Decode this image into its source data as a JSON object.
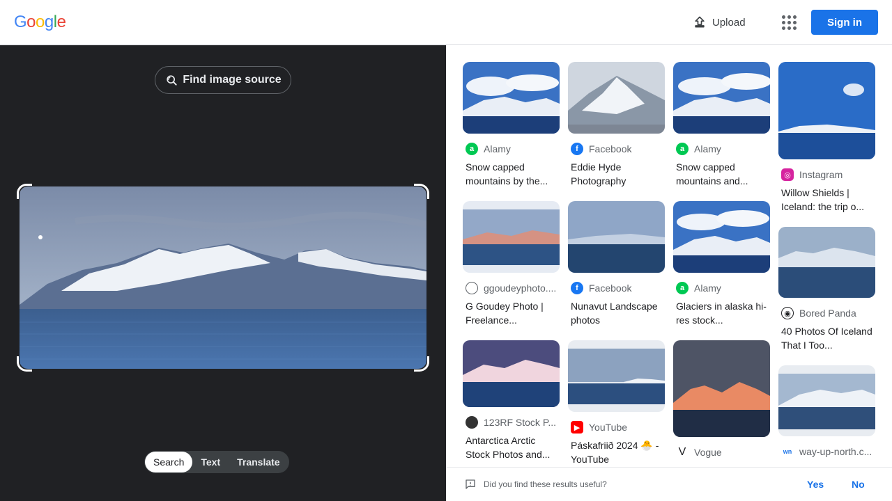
{
  "header": {
    "logo_letters": [
      "G",
      "o",
      "o",
      "g",
      "l",
      "e"
    ],
    "upload_label": "Upload",
    "signin_label": "Sign in"
  },
  "left": {
    "find_source_label": "Find image source",
    "tabs": [
      {
        "label": "Search",
        "active": true
      },
      {
        "label": "Text",
        "active": false
      },
      {
        "label": "Translate",
        "active": false
      }
    ]
  },
  "results": [
    {
      "source": "Alamy",
      "icon": "alamy-icon",
      "title": "Snow capped mountains by the..."
    },
    {
      "source": "Facebook",
      "icon": "facebook-icon",
      "title": "Eddie Hyde Photography"
    },
    {
      "source": "Alamy",
      "icon": "alamy-icon",
      "title": "Snow capped mountains and..."
    },
    {
      "source": "Instagram",
      "icon": "instagram-icon",
      "title": "Willow Shields | Iceland: the trip o..."
    },
    {
      "source": "ggoudeyphoto....",
      "icon": "globe-icon",
      "title": "G Goudey Photo | Freelance..."
    },
    {
      "source": "Facebook",
      "icon": "facebook-icon",
      "title": "Nunavut Landscape photos"
    },
    {
      "source": "Alamy",
      "icon": "alamy-icon",
      "title": "Glaciers in alaska hi-res stock..."
    },
    {
      "source": "Bored Panda",
      "icon": "bored-panda-icon",
      "title": "40 Photos Of Iceland That I Too..."
    },
    {
      "source": "123RF Stock P...",
      "icon": "123rf-icon",
      "title": "Antarctica Arctic Stock Photos and..."
    },
    {
      "source": "YouTube",
      "icon": "youtube-icon",
      "title": "Páskafriið 2024 🐣 - YouTube"
    },
    {
      "source": "Vogue",
      "icon": "vogue-icon",
      "title": ""
    },
    {
      "source": "way-up-north.c...",
      "icon": "way-up-north-icon",
      "title": ""
    }
  ],
  "feedback": {
    "question": "Did you find these results useful?",
    "yes": "Yes",
    "no": "No"
  },
  "colors": {
    "brand_blue": "#1a73e8",
    "dark_pane": "#202124",
    "alamy": "#00c853",
    "facebook": "#1877f2",
    "youtube": "#ff0000"
  }
}
